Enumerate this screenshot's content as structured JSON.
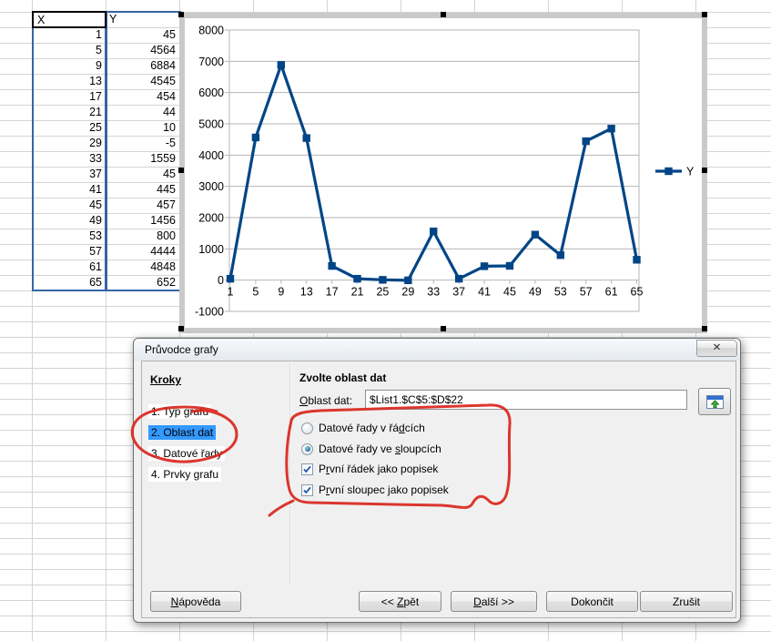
{
  "sheet": {
    "col_headers": [
      "X",
      "Y"
    ],
    "rows": [
      [
        "1",
        "45"
      ],
      [
        "5",
        "4564"
      ],
      [
        "9",
        "6884"
      ],
      [
        "13",
        "4545"
      ],
      [
        "17",
        "454"
      ],
      [
        "21",
        "44"
      ],
      [
        "25",
        "10"
      ],
      [
        "29",
        "-5"
      ],
      [
        "33",
        "1559"
      ],
      [
        "37",
        "45"
      ],
      [
        "41",
        "445"
      ],
      [
        "45",
        "457"
      ],
      [
        "49",
        "1456"
      ],
      [
        "53",
        "800"
      ],
      [
        "57",
        "4444"
      ],
      [
        "61",
        "4848"
      ],
      [
        "65",
        "652"
      ]
    ]
  },
  "chart_data": {
    "type": "line",
    "title": "",
    "categories": [
      1,
      5,
      9,
      13,
      17,
      21,
      25,
      29,
      33,
      37,
      41,
      45,
      49,
      53,
      57,
      61,
      65
    ],
    "series": [
      {
        "name": "Y",
        "values": [
          45,
          4564,
          6884,
          4545,
          454,
          44,
          10,
          -5,
          1559,
          45,
          445,
          457,
          1456,
          800,
          4444,
          4848,
          652
        ]
      }
    ],
    "ylim": [
      -1000,
      8000
    ],
    "ytick_step": 1000,
    "grid": "horizontal",
    "legend_position": "right",
    "line_color": "#004586",
    "marker": "square"
  },
  "dialog": {
    "title": "Průvodce grafy",
    "close_icon": "✕",
    "steps_header": "Kroky",
    "steps": [
      "1. Typ grafu",
      "2. Oblast dat",
      "3. Datové řady",
      "4. Prvky grafu"
    ],
    "active_step_index": 1,
    "section_title": "Zvolte oblast dat",
    "range_field": {
      "label": {
        "pre": "",
        "key": "O",
        "post": "blast dat:"
      },
      "value": "$List1.$C$5:$D$22"
    },
    "options": [
      {
        "type": "radio",
        "checked": false,
        "label": {
          "pre": "Datové řady v řá",
          "key": "d",
          "post": "cích"
        }
      },
      {
        "type": "radio",
        "checked": true,
        "label": {
          "pre": "Datové řady ve ",
          "key": "s",
          "post": "loupcích"
        }
      },
      {
        "type": "checkbox",
        "checked": true,
        "label": {
          "pre": "P",
          "key": "r",
          "post": "vní řádek jako popisek"
        }
      },
      {
        "type": "checkbox",
        "checked": true,
        "label": {
          "pre": "P",
          "key": "r",
          "post": "vní sloupec jako popisek"
        }
      }
    ],
    "buttons": [
      {
        "id": "help",
        "label": {
          "pre": "",
          "key": "N",
          "post": "ápověda"
        }
      },
      {
        "id": "back",
        "label": {
          "pre": "<< ",
          "key": "Z",
          "post": "pět"
        }
      },
      {
        "id": "next",
        "label": {
          "pre": "",
          "key": "D",
          "post": "alší >>"
        }
      },
      {
        "id": "finish",
        "label": {
          "pre": "",
          "key": "",
          "post": "Dokončit"
        }
      },
      {
        "id": "cancel",
        "label": {
          "pre": "",
          "key": "",
          "post": "Zrušit"
        }
      }
    ]
  },
  "colors": {
    "annotation_red": "#d9261c",
    "selection_blue": "#3399ff",
    "range_border_blue": "#3465a4",
    "chart_line": "#004586",
    "chart_grid": "#b6b6b6"
  }
}
